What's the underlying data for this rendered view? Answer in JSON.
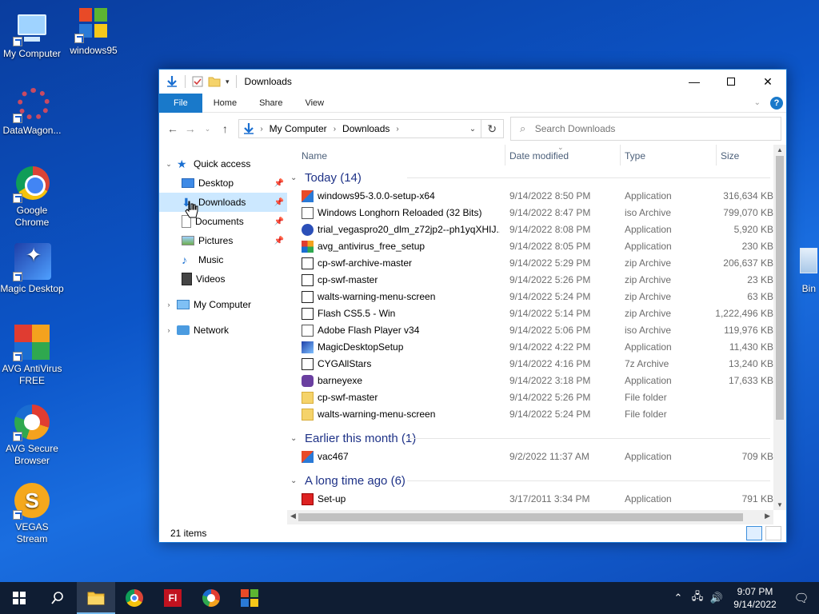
{
  "desktop": {
    "icons": [
      {
        "label": "My Computer"
      },
      {
        "label": "windows95"
      },
      {
        "label": "DataWagon..."
      },
      {
        "label": "Google Chrome"
      },
      {
        "label": "Magic Desktop"
      },
      {
        "label": "AVG AntiVirus FREE"
      },
      {
        "label": "AVG Secure Browser"
      },
      {
        "label": "VEGAS Stream"
      }
    ],
    "vegas_glyph": "S",
    "recycle_label": "Bin"
  },
  "window": {
    "title": "Downloads",
    "ribbon_tabs": [
      "File",
      "Home",
      "Share",
      "View"
    ],
    "address": {
      "root": "My Computer",
      "current": "Downloads"
    },
    "search_placeholder": "Search Downloads",
    "nav": {
      "quick_access": "Quick access",
      "items": [
        "Desktop",
        "Downloads",
        "Documents",
        "Pictures",
        "Music",
        "Videos"
      ],
      "my_computer": "My Computer",
      "network": "Network"
    },
    "columns": {
      "name": "Name",
      "date": "Date modified",
      "type": "Type",
      "size": "Size"
    },
    "groups": [
      {
        "title": "Today (14)",
        "files": [
          {
            "name": "windows95-3.0.0-setup-x64",
            "date": "9/14/2022 8:50 PM",
            "type": "Application",
            "size": "316,634 KB",
            "icon": "win-app-icon"
          },
          {
            "name": "Windows Longhorn Reloaded (32 Bits)",
            "date": "9/14/2022 8:47 PM",
            "type": "iso Archive",
            "size": "799,070 KB",
            "icon": "iso-icon"
          },
          {
            "name": "trial_vegaspro20_dlm_z72jp2--ph1yqXHIJ...",
            "date": "9/14/2022 8:08 PM",
            "type": "Application",
            "size": "5,920 KB",
            "icon": "vegas-icon"
          },
          {
            "name": "avg_antivirus_free_setup",
            "date": "9/14/2022 8:05 PM",
            "type": "Application",
            "size": "230 KB",
            "icon": "avg-icon"
          },
          {
            "name": "cp-swf-archive-master",
            "date": "9/14/2022 5:29 PM",
            "type": "zip Archive",
            "size": "206,637 KB",
            "icon": "zip-icon"
          },
          {
            "name": "cp-swf-master",
            "date": "9/14/2022 5:26 PM",
            "type": "zip Archive",
            "size": "23 KB",
            "icon": "zip-icon"
          },
          {
            "name": "walts-warning-menu-screen",
            "date": "9/14/2022 5:24 PM",
            "type": "zip Archive",
            "size": "63 KB",
            "icon": "zip-icon"
          },
          {
            "name": "Flash CS5.5 - Win",
            "date": "9/14/2022 5:14 PM",
            "type": "zip Archive",
            "size": "1,222,496 KB",
            "icon": "zip-icon"
          },
          {
            "name": "Adobe Flash Player v34",
            "date": "9/14/2022 5:06 PM",
            "type": "iso Archive",
            "size": "119,976 KB",
            "icon": "iso-icon"
          },
          {
            "name": "MagicDesktopSetup",
            "date": "9/14/2022 4:22 PM",
            "type": "Application",
            "size": "11,430 KB",
            "icon": "magic-icon"
          },
          {
            "name": "CYGAllStars",
            "date": "9/14/2022 4:16 PM",
            "type": "7z Archive",
            "size": "13,240 KB",
            "icon": "7z-icon"
          },
          {
            "name": "barneyexe",
            "date": "9/14/2022 3:18 PM",
            "type": "Application",
            "size": "17,633 KB",
            "icon": "barney-icon"
          },
          {
            "name": "cp-swf-master",
            "date": "9/14/2022 5:26 PM",
            "type": "File folder",
            "size": "",
            "icon": "folder-icon"
          },
          {
            "name": "walts-warning-menu-screen",
            "date": "9/14/2022 5:24 PM",
            "type": "File folder",
            "size": "",
            "icon": "folder-icon"
          }
        ]
      },
      {
        "title": "Earlier this month (1)",
        "files": [
          {
            "name": "vac467",
            "date": "9/2/2022 11:37 AM",
            "type": "Application",
            "size": "709 KB",
            "icon": "win-app-icon"
          }
        ]
      },
      {
        "title": "A long time ago (6)",
        "files": [
          {
            "name": "Set-up",
            "date": "3/17/2011 3:34 PM",
            "type": "Application",
            "size": "791 KB",
            "icon": "setup-icon"
          }
        ]
      }
    ],
    "status": "21 items"
  },
  "taskbar": {
    "time": "9:07 PM",
    "date": "9/14/2022",
    "flash_label": "Fl"
  }
}
